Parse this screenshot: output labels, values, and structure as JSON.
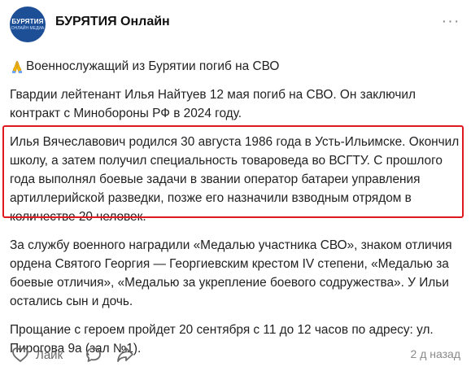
{
  "header": {
    "avatar_logo": "БУРЯТИЯ",
    "avatar_sub": "ОНЛАЙН МЕДИА",
    "group_name": "БУРЯТИЯ Онлайн",
    "more_label": "···"
  },
  "post": {
    "headline": "Военнослужащий из Бурятии погиб на СВО",
    "p1": "Гвардии лейтенант Илья Найтуев 12 мая погиб на СВО. Он заключил контракт с Минобороны РФ в 2024 году.",
    "p2": "Илья Вячеславович родился 30 августа 1986 года в Усть-Ильимске. Окончил школу, а затем получил специальность товароведа во ВСГТУ. С прошлого года выполнял боевые задачи в звании оператор батареи управления артиллерийской разведки, позже его назначили взводным отрядом в количестве 20 человек.",
    "p3": "За службу военного наградили «Медалью участника СВО», знаком отличия ордена Святого Георгия — Георгиевским крестом IV степени, «Медалью за боевые отличия», «Медалью за укрепление боевого содружества». У Ильи остались сын и дочь.",
    "p4": "Прощание с героем пройдет 20 сентября с 11 до 12 часов по адресу: ул. Пирогова 9а (зал №1)."
  },
  "footer": {
    "like_label": "Лайк",
    "timestamp": "2 д назад"
  },
  "colors": {
    "highlight_border": "#e0191f",
    "avatar_bg": "#1d4f96",
    "muted": "#6a6a6a"
  },
  "icons": {
    "headline": "folded-hands-icon",
    "like": "heart-icon",
    "comment": "comment-bubble-icon",
    "share": "share-arrow-icon",
    "more": "more-dots-icon"
  }
}
